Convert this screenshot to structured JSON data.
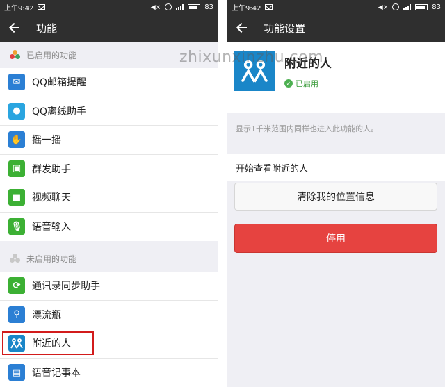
{
  "status_bar": {
    "time": "上午9:42",
    "battery": "83"
  },
  "left": {
    "title": "功能",
    "enabled_section": "已启用的功能",
    "enabled_items": [
      {
        "label": "QQ邮箱提醒",
        "icon": "mail-icon",
        "color": "#2b7fd4"
      },
      {
        "label": "QQ离线助手",
        "icon": "qq-penguin-icon",
        "color": "#2aa5e0"
      },
      {
        "label": "摇一摇",
        "icon": "shake-hand-icon",
        "color": "#2b7fd4"
      },
      {
        "label": "群发助手",
        "icon": "broadcast-icon",
        "color": "#3cb034"
      },
      {
        "label": "视频聊天",
        "icon": "video-camera-icon",
        "color": "#3cb034"
      },
      {
        "label": "语音输入",
        "icon": "microphone-icon",
        "color": "#3cb034"
      }
    ],
    "disabled_section": "未启用的功能",
    "disabled_items": [
      {
        "label": "通讯录同步助手",
        "icon": "contact-sync-icon",
        "color": "#3cb034"
      },
      {
        "label": "漂流瓶",
        "icon": "drift-bottle-icon",
        "color": "#2b7fd4"
      },
      {
        "label": "附近的人",
        "icon": "people-nearby-icon",
        "color": "#1a86c8"
      },
      {
        "label": "语音记事本",
        "icon": "voice-notepad-icon",
        "color": "#2b7fd4"
      }
    ],
    "highlight_color": "#d21b1b"
  },
  "right": {
    "title": "功能设置",
    "feature_name": "附近的人",
    "status": "已启用",
    "description": "显示1千米范围内同样也进入此功能的人。",
    "view_nearby": "开始查看附近的人",
    "clear_location": "清除我的位置信息",
    "disable_button": "停用",
    "danger_color": "#e64340"
  },
  "watermark": "zhixunxinzhu.com"
}
